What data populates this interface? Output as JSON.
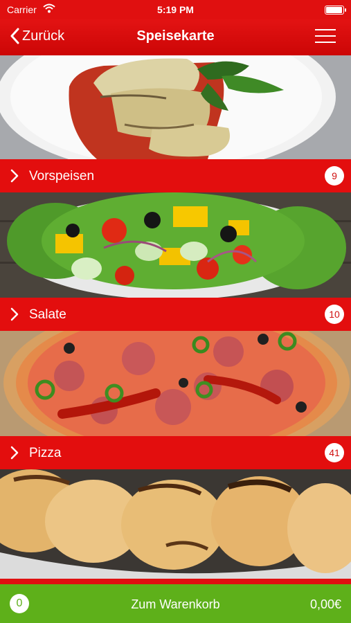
{
  "status": {
    "carrier": "Carrier",
    "time": "5:19 PM",
    "battery_fill": 0.95
  },
  "nav": {
    "back_label": "Zurück",
    "title": "Speisekarte"
  },
  "categories": [
    {
      "label": "Vorspeisen",
      "count": "9"
    },
    {
      "label": "Salate",
      "count": "10"
    },
    {
      "label": "Pizza",
      "count": "41"
    }
  ],
  "cart": {
    "count": "0",
    "label": "Zum Warenkorb",
    "price": "0,00€"
  },
  "colors": {
    "primary_red": "#e30e0e",
    "cart_green": "#5eb01a"
  }
}
